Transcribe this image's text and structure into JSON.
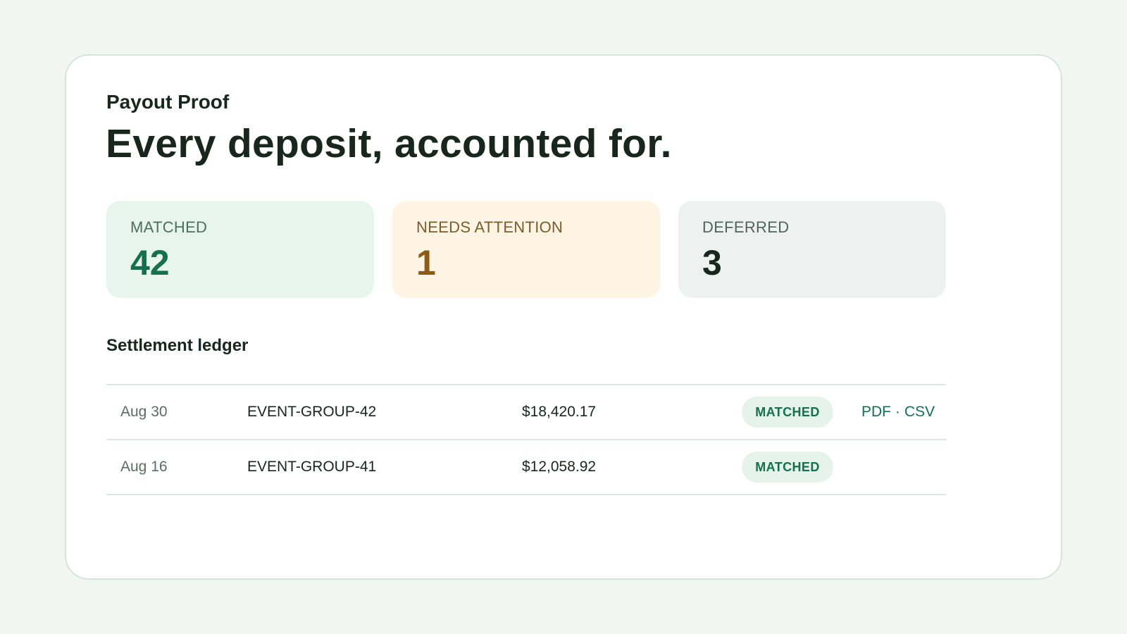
{
  "header": {
    "eyebrow": "Payout Proof",
    "headline": "Every deposit, accounted for."
  },
  "stats": [
    {
      "label": "MATCHED",
      "value": "42"
    },
    {
      "label": "NEEDS ATTENTION",
      "value": "1"
    },
    {
      "label": "DEFERRED",
      "value": "3"
    }
  ],
  "ledger": {
    "title": "Settlement ledger",
    "rows": [
      {
        "date": "Aug 30",
        "reference": "EVENT-GROUP-42",
        "amount": "$18,420.17",
        "status": "MATCHED",
        "pdf": "PDF",
        "separator": "·",
        "csv": "CSV"
      },
      {
        "date": "Aug 16",
        "reference": "EVENT-GROUP-41",
        "amount": "$12,058.92",
        "status": "MATCHED"
      }
    ]
  },
  "colors": {
    "background": "#f1f6f2",
    "accent_green": "#14704f",
    "attention_amber": "#8c5b0f",
    "text_dark": "#17261f"
  }
}
